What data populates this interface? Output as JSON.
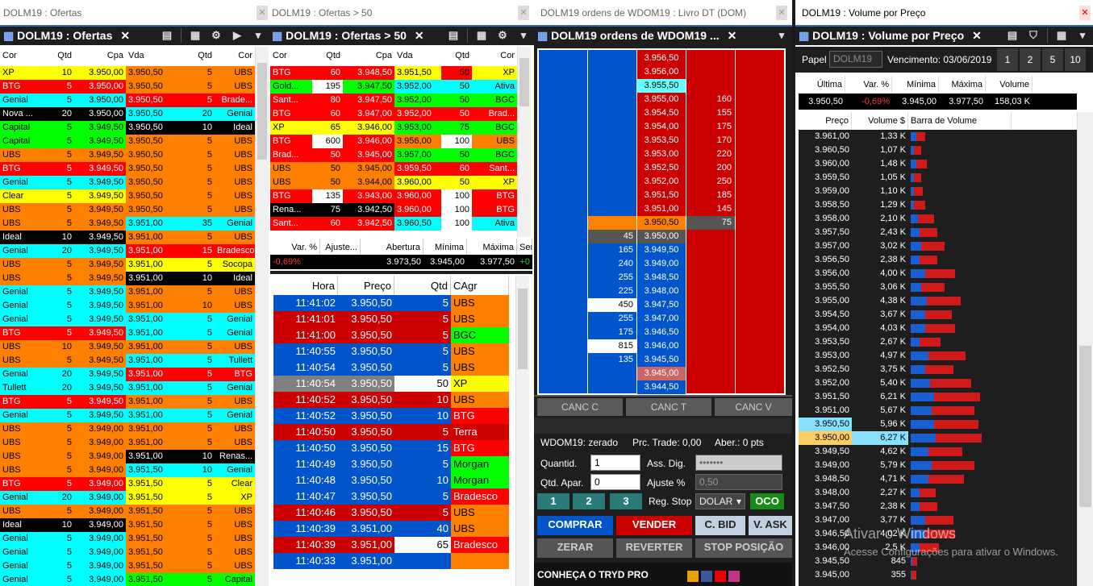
{
  "w1": {
    "title": "DOLM19 : Ofertas",
    "tab": "DOLM19 : Ofertas",
    "cols": [
      "Cor",
      "Qtd",
      "Cpa",
      "Vda",
      "Qtd",
      "Cor"
    ],
    "rows": [
      [
        "XP",
        "10",
        "3.950,00",
        "3.950,50",
        "5",
        "UBS",
        "#ffff00",
        "#000",
        "#ff8000",
        "#000"
      ],
      [
        "BTG",
        "5",
        "3.950,00",
        "3.950,50",
        "5",
        "UBS",
        "#ff0000",
        "#fff",
        "#ff8000",
        "#000"
      ],
      [
        "Genial",
        "5",
        "3.950,00",
        "3.950,50",
        "5",
        "Brade...",
        "#00ffff",
        "#000",
        "#ff0000",
        "#fff"
      ],
      [
        "Nova ...",
        "20",
        "3.950,00",
        "3.950,50",
        "20",
        "Genial",
        "#000000",
        "#fff",
        "#00ffff",
        "#000"
      ],
      [
        "Capital",
        "5",
        "3.949,50",
        "3.950,50",
        "10",
        "Ideal",
        "#00ff00",
        "#000",
        "#000000",
        "#fff"
      ],
      [
        "Capital",
        "5",
        "3.949,50",
        "3.950,50",
        "5",
        "UBS",
        "#00ff00",
        "#000",
        "#ff8000",
        "#000"
      ],
      [
        "UBS",
        "5",
        "3.949,50",
        "3.950,50",
        "5",
        "UBS",
        "#ff8000",
        "#000",
        "#ff8000",
        "#000"
      ],
      [
        "BTG",
        "5",
        "3.949,50",
        "3.950,50",
        "5",
        "UBS",
        "#ff0000",
        "#fff",
        "#ff8000",
        "#000"
      ],
      [
        "Genial",
        "5",
        "3.949,50",
        "3.950,50",
        "5",
        "UBS",
        "#00ffff",
        "#000",
        "#ff8000",
        "#000"
      ],
      [
        "Clear",
        "5",
        "3.949,50",
        "3.950,50",
        "5",
        "UBS",
        "#ffff00",
        "#000",
        "#ff8000",
        "#000"
      ],
      [
        "UBS",
        "5",
        "3.949,50",
        "3.950,50",
        "5",
        "UBS",
        "#ff8000",
        "#000",
        "#ff8000",
        "#000"
      ],
      [
        "UBS",
        "5",
        "3.949,50",
        "3.951,00",
        "35",
        "Genial",
        "#ff8000",
        "#000",
        "#00ffff",
        "#000"
      ],
      [
        "Ideal",
        "10",
        "3.949,50",
        "3.951,00",
        "5",
        "UBS",
        "#000000",
        "#fff",
        "#ff8000",
        "#000"
      ],
      [
        "Genial",
        "20",
        "3.949,50",
        "3.951,00",
        "15",
        "Bradesco",
        "#00ffff",
        "#000",
        "#ff0000",
        "#fff"
      ],
      [
        "UBS",
        "5",
        "3.949,50",
        "3.951,00",
        "5",
        "Socopa",
        "#ff8000",
        "#000",
        "#ffff00",
        "#000"
      ],
      [
        "UBS",
        "5",
        "3.949,50",
        "3.951,00",
        "10",
        "Ideal",
        "#ff8000",
        "#000",
        "#000000",
        "#fff"
      ],
      [
        "Genial",
        "5",
        "3.949,50",
        "3.951,00",
        "5",
        "UBS",
        "#00ffff",
        "#000",
        "#ff8000",
        "#000"
      ],
      [
        "Genial",
        "5",
        "3.949,50",
        "3.951,00",
        "10",
        "UBS",
        "#00ffff",
        "#000",
        "#ff8000",
        "#000"
      ],
      [
        "Genial",
        "5",
        "3.949,50",
        "3.951,00",
        "5",
        "Genial",
        "#00ffff",
        "#000",
        "#00ffff",
        "#000"
      ],
      [
        "BTG",
        "5",
        "3.949,50",
        "3.951,00",
        "5",
        "Genial",
        "#ff0000",
        "#fff",
        "#00ffff",
        "#000"
      ],
      [
        "UBS",
        "10",
        "3.949,50",
        "3.951,00",
        "5",
        "UBS",
        "#ff8000",
        "#000",
        "#ff8000",
        "#000"
      ],
      [
        "UBS",
        "5",
        "3.949,50",
        "3.951,00",
        "5",
        "Tullett",
        "#ff8000",
        "#000",
        "#00ffff",
        "#000"
      ],
      [
        "Genial",
        "20",
        "3.949,50",
        "3.951,00",
        "5",
        "BTG",
        "#00ffff",
        "#000",
        "#ff0000",
        "#fff"
      ],
      [
        "Tullett",
        "20",
        "3.949,50",
        "3.951,00",
        "5",
        "Genial",
        "#00ffff",
        "#000",
        "#00ffff",
        "#000"
      ],
      [
        "BTG",
        "5",
        "3.949,50",
        "3.951,00",
        "5",
        "UBS",
        "#ff0000",
        "#fff",
        "#ff8000",
        "#000"
      ],
      [
        "Genial",
        "5",
        "3.949,50",
        "3.951,00",
        "5",
        "Genial",
        "#00ffff",
        "#000",
        "#00ffff",
        "#000"
      ],
      [
        "UBS",
        "5",
        "3.949,00",
        "3.951,00",
        "5",
        "UBS",
        "#ff8000",
        "#000",
        "#ff8000",
        "#000"
      ],
      [
        "UBS",
        "5",
        "3.949,00",
        "3.951,00",
        "5",
        "UBS",
        "#ff8000",
        "#000",
        "#ff8000",
        "#000"
      ],
      [
        "UBS",
        "5",
        "3.949,00",
        "3.951,00",
        "10",
        "Renas...",
        "#ff8000",
        "#000",
        "#000000",
        "#fff"
      ],
      [
        "UBS",
        "5",
        "3.949,00",
        "3.951,50",
        "10",
        "Genial",
        "#ff8000",
        "#000",
        "#00ffff",
        "#000"
      ],
      [
        "BTG",
        "5",
        "3.949,00",
        "3.951,50",
        "5",
        "Clear",
        "#ff0000",
        "#fff",
        "#ffff00",
        "#000"
      ],
      [
        "Genial",
        "20",
        "3.949,00",
        "3.951,50",
        "5",
        "XP",
        "#00ffff",
        "#000",
        "#ffff00",
        "#000"
      ],
      [
        "UBS",
        "5",
        "3.949,00",
        "3.951,50",
        "5",
        "UBS",
        "#ff8000",
        "#000",
        "#ff8000",
        "#000"
      ],
      [
        "Ideal",
        "10",
        "3.949,00",
        "3.951,50",
        "5",
        "UBS",
        "#000000",
        "#fff",
        "#ff8000",
        "#000"
      ],
      [
        "Genial",
        "5",
        "3.949,00",
        "3.951,50",
        "5",
        "UBS",
        "#00ffff",
        "#000",
        "#ff8000",
        "#000"
      ],
      [
        "Genial",
        "5",
        "3.949,00",
        "3.951,50",
        "5",
        "UBS",
        "#00ffff",
        "#000",
        "#ff8000",
        "#000"
      ],
      [
        "Genial",
        "5",
        "3.949,00",
        "3.951,50",
        "5",
        "UBS",
        "#00ffff",
        "#000",
        "#ff8000",
        "#000"
      ],
      [
        "Genial",
        "5",
        "3.949,00",
        "3.951,50",
        "5",
        "Capital",
        "#00ffff",
        "#000",
        "#00ff00",
        "#000"
      ]
    ]
  },
  "w2": {
    "title": "DOLM19 : Ofertas > 50",
    "tab": "DOLM19 : Ofertas > 50",
    "cols": [
      "Cor",
      "Qtd",
      "Cpa",
      "Vda",
      "Qtd",
      "Cor"
    ],
    "rows": [
      [
        "BTG",
        "60",
        "3.948,50",
        "3.951,50",
        "50",
        "XP",
        "#ff0000",
        "#fff",
        "#ffff00",
        "#000",
        "#ff0000",
        "#ff0000"
      ],
      [
        "Gold...",
        "195",
        "3.947,50",
        "3.952,00",
        "50",
        "Ativa",
        "#00ff00",
        "#000",
        "#00ffff",
        "#000",
        "#ffffff",
        "#00ffff"
      ],
      [
        "Sant...",
        "80",
        "3.947,50",
        "3.952,00",
        "50",
        "BGC",
        "#ff0000",
        "#fff",
        "#00ff00",
        "#000",
        "#ff0000",
        "#00ff00"
      ],
      [
        "BTG",
        "60",
        "3.947,00",
        "3.952,00",
        "50",
        "Brad...",
        "#ff0000",
        "#fff",
        "#ff0000",
        "#fff",
        "#ff0000",
        "#ff0000"
      ],
      [
        "XP",
        "65",
        "3.946,00",
        "3.953,00",
        "75",
        "BGC",
        "#ffff00",
        "#000",
        "#00ff00",
        "#000",
        "#ffff00",
        "#00ff00"
      ],
      [
        "BTG",
        "600",
        "3.946,00",
        "3.956,00",
        "100",
        "UBS",
        "#ff0000",
        "#fff",
        "#ff8000",
        "#000",
        "#ffffff",
        "#ffffff"
      ],
      [
        "Brad...",
        "50",
        "3.945,00",
        "3.957,00",
        "50",
        "BGC",
        "#ff0000",
        "#fff",
        "#00ff00",
        "#000",
        "#ff0000",
        "#00ff00"
      ],
      [
        "UBS",
        "50",
        "3.945,00",
        "3.959,50",
        "60",
        "Sant...",
        "#ff8000",
        "#000",
        "#ff0000",
        "#fff",
        "#ff8000",
        "#ff0000"
      ],
      [
        "UBS",
        "50",
        "3.944,00",
        "3.960,00",
        "50",
        "XP",
        "#ff8000",
        "#000",
        "#ffff00",
        "#000",
        "#ff8000",
        "#ffff00"
      ],
      [
        "BTG",
        "135",
        "3.943,00",
        "3.960,00",
        "100",
        "BTG",
        "#ff0000",
        "#fff",
        "#ff0000",
        "#fff",
        "#ffffff",
        "#ffffff"
      ],
      [
        "Rena...",
        "75",
        "3.942,50",
        "3.960,00",
        "100",
        "BTG",
        "#000000",
        "#fff",
        "#ff0000",
        "#fff",
        "#000000",
        "#ffffff"
      ],
      [
        "Sant...",
        "60",
        "3.942,50",
        "3.960,50",
        "100",
        "Ativa",
        "#ff0000",
        "#fff",
        "#00ffff",
        "#000",
        "#ff0000",
        "#ffffff"
      ]
    ],
    "summary_cols": [
      "Var. %",
      "Ajuste...",
      "Abertura",
      "Mínima",
      "Máxima",
      "Ser"
    ],
    "summary_vals": [
      "-0,69%",
      "",
      "3.973,50",
      "3.945,00",
      "3.977,50",
      "+0"
    ],
    "trade_cols": [
      "Hora",
      "Preço",
      "Qtd",
      "CAgr"
    ],
    "trades": [
      [
        "11:41:02",
        "3.950,50",
        "5",
        "UBS",
        "#0055cc",
        "#ff8000",
        "#000"
      ],
      [
        "11:41:01",
        "3.950,50",
        "5",
        "UBS",
        "#cc0000",
        "#ff8000",
        "#000"
      ],
      [
        "11:41:00",
        "3.950,50",
        "5",
        "BGC",
        "#cc0000",
        "#00ff00",
        "#000"
      ],
      [
        "11:40:55",
        "3.950,50",
        "5",
        "UBS",
        "#0055cc",
        "#ff8000",
        "#000"
      ],
      [
        "11:40:54",
        "3.950,50",
        "5",
        "UBS",
        "#0055cc",
        "#ff8000",
        "#000"
      ],
      [
        "11:40:54",
        "3.950,50",
        "50",
        "XP",
        "#808080",
        "#ffff00",
        "#000"
      ],
      [
        "11:40:52",
        "3.950,50",
        "10",
        "UBS",
        "#cc0000",
        "#ff8000",
        "#000"
      ],
      [
        "11:40:52",
        "3.950,50",
        "10",
        "BTG",
        "#0055cc",
        "#ff0000",
        "#fff"
      ],
      [
        "11:40:50",
        "3.950,50",
        "5",
        "Terra",
        "#cc0000",
        "#cc0000",
        "#fff"
      ],
      [
        "11:40:50",
        "3.950,50",
        "15",
        "BTG",
        "#0055cc",
        "#ff0000",
        "#fff"
      ],
      [
        "11:40:49",
        "3.950,50",
        "5",
        "Morgan",
        "#0055cc",
        "#00ff00",
        "#000"
      ],
      [
        "11:40:48",
        "3.950,50",
        "10",
        "Morgan",
        "#0055cc",
        "#00ff00",
        "#000"
      ],
      [
        "11:40:47",
        "3.950,50",
        "5",
        "Bradesco",
        "#0055cc",
        "#ff0000",
        "#fff"
      ],
      [
        "11:40:46",
        "3.950,50",
        "5",
        "UBS",
        "#cc0000",
        "#ff8000",
        "#000"
      ],
      [
        "11:40:39",
        "3.951,00",
        "40",
        "UBS",
        "#0055cc",
        "#ff8000",
        "#000"
      ],
      [
        "11:40:39",
        "3.951,00",
        "65",
        "Bradesco",
        "#cc0000",
        "#ff0000",
        "#fff"
      ],
      [
        "11:40:33",
        "3.951,00",
        "",
        "",
        "#0055cc",
        "#ff8000",
        "#000"
      ]
    ]
  },
  "w3": {
    "title": "DOLM19 ordens de WDOM19 : Livro DT (DOM)",
    "tab": "DOLM19 ordens de WDOM19 ...",
    "ask": [
      [
        "3.956,50",
        ""
      ],
      [
        "3.956,00",
        ""
      ],
      [
        "3.955,50",
        ""
      ],
      [
        "3.955,00",
        "160"
      ],
      [
        "3.954,50",
        "155"
      ],
      [
        "3.954,00",
        "175"
      ],
      [
        "3.953,50",
        "170"
      ],
      [
        "3.953,00",
        "220"
      ],
      [
        "3.952,50",
        "200"
      ],
      [
        "3.952,00",
        "250"
      ],
      [
        "3.951,50",
        "185"
      ],
      [
        "3.951,00",
        "145"
      ],
      [
        "3.950,50",
        "75"
      ]
    ],
    "bid": [
      [
        "3.950,00",
        "45"
      ],
      [
        "3.949,50",
        "165"
      ],
      [
        "3.949,00",
        "240"
      ],
      [
        "3.948,50",
        "255"
      ],
      [
        "3.948,00",
        "225"
      ],
      [
        "3.947,50",
        "450"
      ],
      [
        "3.947,00",
        "255"
      ],
      [
        "3.946,50",
        "175"
      ],
      [
        "3.946,00",
        "815"
      ],
      [
        "3.945,50",
        "135"
      ],
      [
        "3.945,00",
        ""
      ],
      [
        "3.944,50",
        ""
      ]
    ],
    "canc_c": "CANC C",
    "canc_t": "CANC T",
    "canc_v": "CANC V",
    "status": "WDOM19: zerado",
    "prc_trade": "Prc. Trade: 0,00",
    "aber": "Aber.: 0 pts",
    "quantid_label": "Quantid.",
    "quantid_val": "1",
    "ass_dig_label": "Ass. Dig.",
    "ass_dig_val": "•••••••",
    "qtd_apar_label": "Qtd. Apar.",
    "qtd_apar_val": "0",
    "ajuste_label": "Ajuste %",
    "ajuste_val": "0,50",
    "q1": "1",
    "q2": "2",
    "q3": "3",
    "reg_stop_label": "Reg. Stop",
    "reg_stop_val": "DOLAR",
    "oco": "OCO",
    "comprar": "COMPRAR",
    "vender": "VENDER",
    "cbid": "C. BID",
    "vask": "V. ASK",
    "zerar": "ZERAR",
    "reverter": "REVERTER",
    "stop": "STOP POSIÇÃO",
    "taskbar_text": "CONHEÇA O TRYD PRO"
  },
  "w4": {
    "title": "DOLM19 : Volume por Preço",
    "tab": "DOLM19 : Volume por Preço",
    "papel_label": "Papel",
    "papel_val": "DOLM19",
    "venc": "Vencimento: 03/06/2019",
    "periods": [
      "1",
      "2",
      "5",
      "10"
    ],
    "stat_cols": [
      "Última",
      "Var. %",
      "Mínima",
      "Máxima",
      "Volume"
    ],
    "stat_vals": [
      "3.950,50",
      "-0,69%",
      "3.945,00",
      "3.977,50",
      "158,03 K"
    ],
    "cols": [
      "Preço",
      "Volume $",
      "Barra de Volume"
    ],
    "rows": [
      [
        "3.961,00",
        "1,33 K",
        0.3,
        0.5
      ],
      [
        "3.960,50",
        "1,07 K",
        0.2,
        0.4
      ],
      [
        "3.960,00",
        "1,48 K",
        0.3,
        0.6
      ],
      [
        "3.959,50",
        "1,05 K",
        0.2,
        0.4
      ],
      [
        "3.959,00",
        "1,10 K",
        0.2,
        0.5
      ],
      [
        "3.958,50",
        "1,29 K",
        0.2,
        0.6
      ],
      [
        "3.958,00",
        "2,10 K",
        0.4,
        0.9
      ],
      [
        "3.957,50",
        "2,43 K",
        0.5,
        1.0
      ],
      [
        "3.957,00",
        "3,02 K",
        0.6,
        1.3
      ],
      [
        "3.956,50",
        "2,38 K",
        0.5,
        1.0
      ],
      [
        "3.956,00",
        "4,00 K",
        0.8,
        1.7
      ],
      [
        "3.955,50",
        "3,06 K",
        0.6,
        1.3
      ],
      [
        "3.955,00",
        "4,38 K",
        0.9,
        1.9
      ],
      [
        "3.954,50",
        "3,67 K",
        0.8,
        1.5
      ],
      [
        "3.954,00",
        "4,03 K",
        0.8,
        1.7
      ],
      [
        "3.953,50",
        "2,67 K",
        0.5,
        1.2
      ],
      [
        "3.953,00",
        "4,97 K",
        1.0,
        2.1
      ],
      [
        "3.952,50",
        "3,75 K",
        0.8,
        1.6
      ],
      [
        "3.952,00",
        "5,40 K",
        1.1,
        2.3
      ],
      [
        "3.951,50",
        "6,21 K",
        1.3,
        2.6
      ],
      [
        "3.951,00",
        "5,67 K",
        1.2,
        2.4
      ],
      [
        "3.950,50",
        "5,96 K",
        1.3,
        2.5
      ],
      [
        "3.950,00",
        "6,27 K",
        1.4,
        2.6
      ],
      [
        "3.949,50",
        "4,62 K",
        1.0,
        1.9
      ],
      [
        "3.949,00",
        "5,79 K",
        1.2,
        2.4
      ],
      [
        "3.948,50",
        "4,71 K",
        1.0,
        2.0
      ],
      [
        "3.948,00",
        "2,27 K",
        0.5,
        0.9
      ],
      [
        "3.947,50",
        "2,38 K",
        0.5,
        1.0
      ],
      [
        "3.947,00",
        "3,77 K",
        0.8,
        1.6
      ],
      [
        "3.946,50",
        "4,02 K",
        0.8,
        1.7
      ],
      [
        "3.946,00",
        "2,5 K",
        0.5,
        1.1
      ],
      [
        "3.945,50",
        "845",
        0.1,
        0.2
      ],
      [
        "3.945,00",
        "355",
        0.05,
        0.1
      ]
    ],
    "watermark1": "Ativar o Windows",
    "watermark2": "Acesse Configurações para ativar o Windows."
  }
}
